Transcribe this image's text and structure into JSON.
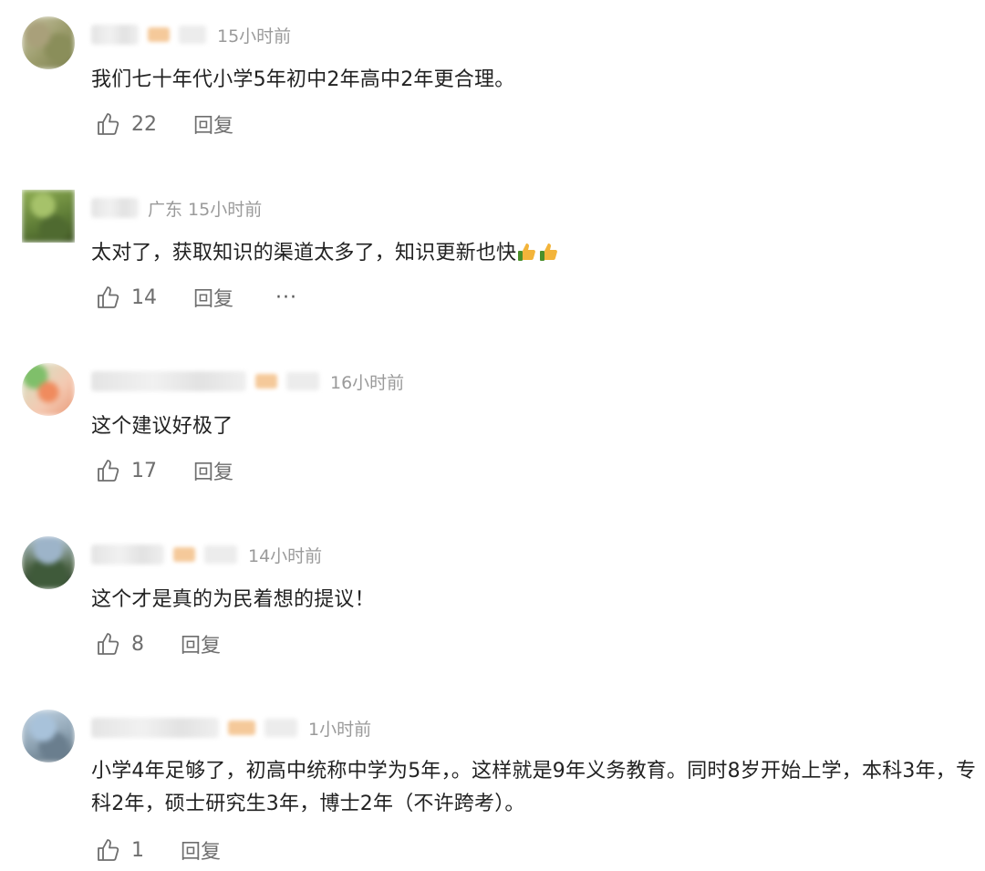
{
  "comments": [
    {
      "location": "",
      "time": "15小时前",
      "text": "我们七十年代小学5年初中2年高中2年更合理。",
      "likes": "22",
      "reply_label": "回复"
    },
    {
      "location": "广东",
      "time": "15小时前",
      "text": "太对了，获取知识的渠道太多了，知识更新也快",
      "emoji": [
        "thumbs-up",
        "thumbs-up"
      ],
      "likes": "14",
      "reply_label": "回复",
      "more_label": "···"
    },
    {
      "location": "",
      "time": "16小时前",
      "text": "这个建议好极了",
      "likes": "17",
      "reply_label": "回复"
    },
    {
      "location": "",
      "time": "14小时前",
      "text": "这个才是真的为民着想的提议！",
      "likes": "8",
      "reply_label": "回复"
    },
    {
      "location": "",
      "time": "1小时前",
      "text": "小学4年足够了，初高中统称中学为5年，。这样就是9年义务教育。同时8岁开始上学，本科3年，专科2年，硕士研究生3年，博士2年（不许跨考）。",
      "likes": "1",
      "reply_label": "回复"
    }
  ],
  "colors": {
    "meta": "#9a9a9a",
    "text": "#222222",
    "action": "#6e6e6e"
  },
  "icons": {
    "like": "thumbs-up-outline-icon",
    "emoji": "thumbs-up-emoji-icon",
    "more": "more-dots-icon"
  }
}
